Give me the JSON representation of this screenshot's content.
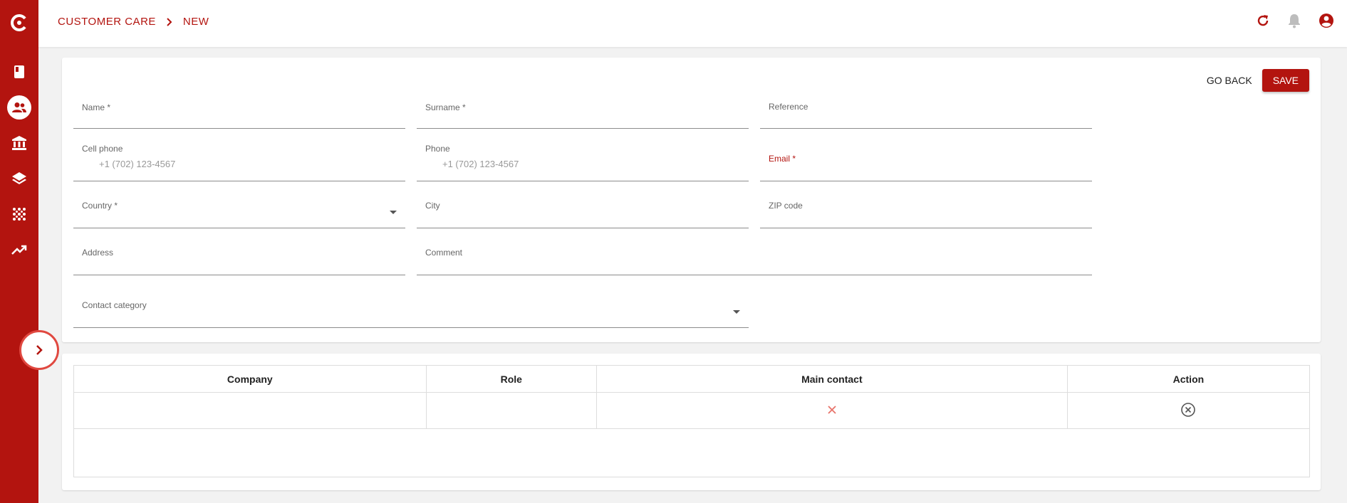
{
  "breadcrumb": {
    "section": "CUSTOMER CARE",
    "current": "NEW"
  },
  "sidebar": {
    "items": [
      {
        "icon": "app-logo-icon"
      },
      {
        "icon": "book-icon"
      },
      {
        "icon": "contacts-icon",
        "active": true
      },
      {
        "icon": "bank-icon"
      },
      {
        "icon": "layers-icon"
      },
      {
        "icon": "dots-grid-icon"
      },
      {
        "icon": "trending-up-icon"
      }
    ],
    "expand_icon": "chevron-right-icon"
  },
  "topbar": {
    "icons": [
      "refresh-icon",
      "bell-icon",
      "account-icon"
    ]
  },
  "actions": {
    "go_back": "GO BACK",
    "save": "SAVE"
  },
  "form": {
    "name": {
      "label": "Name *"
    },
    "surname": {
      "label": "Surname *"
    },
    "reference": {
      "label": "Reference"
    },
    "cell_phone": {
      "label": "Cell phone",
      "placeholder": "+1 (702) 123-4567"
    },
    "phone": {
      "label": "Phone",
      "placeholder": "+1 (702) 123-4567"
    },
    "email": {
      "label": "Email *"
    },
    "country": {
      "label": "Country *"
    },
    "city": {
      "label": "City"
    },
    "zip": {
      "label": "ZIP code"
    },
    "address": {
      "label": "Address"
    },
    "comment": {
      "label": "Comment"
    },
    "contact_category": {
      "label": "Contact category"
    }
  },
  "table": {
    "columns": [
      "Company",
      "Role",
      "Main contact",
      "Action"
    ],
    "rows": [
      {
        "company": "",
        "role": "",
        "main_contact": "false",
        "action": "remove"
      }
    ]
  },
  "colors": {
    "brand": "#b3140f",
    "background": "#f2f2f2"
  }
}
